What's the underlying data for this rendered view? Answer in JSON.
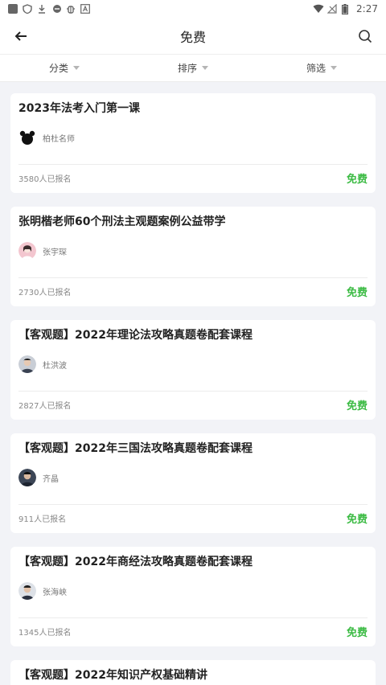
{
  "status_bar": {
    "time": "2:27"
  },
  "header": {
    "title": "免费"
  },
  "filters": [
    {
      "label": "分类"
    },
    {
      "label": "排序"
    },
    {
      "label": "筛选"
    }
  ],
  "courses": [
    {
      "title": "2023年法考入门第一课",
      "teacher": "柏杜名师",
      "enrolled": "3580人已报名",
      "price": "免费",
      "avatar_color": "#111111"
    },
    {
      "title": "张明楷老师60个刑法主观题案例公益带学",
      "teacher": "张宇琛",
      "enrolled": "2730人已报名",
      "price": "免费",
      "avatar_color": "#f3c6cf"
    },
    {
      "title": "【客观题】2022年理论法攻略真题卷配套课程",
      "teacher": "杜洪波",
      "enrolled": "2827人已报名",
      "price": "免费",
      "avatar_color": "#7d8796"
    },
    {
      "title": "【客观题】2022年三国法攻略真题卷配套课程",
      "teacher": "齐晶",
      "enrolled": "911人已报名",
      "price": "免费",
      "avatar_color": "#3c4656"
    },
    {
      "title": "【客观题】2022年商经法攻略真题卷配套课程",
      "teacher": "张海峡",
      "enrolled": "1345人已报名",
      "price": "免费",
      "avatar_color": "#5c6779"
    },
    {
      "title": "【客观题】2022年知识产权基础精讲"
    }
  ],
  "colors": {
    "price_green": "#3cbb44",
    "background": "#f2f3f7"
  }
}
